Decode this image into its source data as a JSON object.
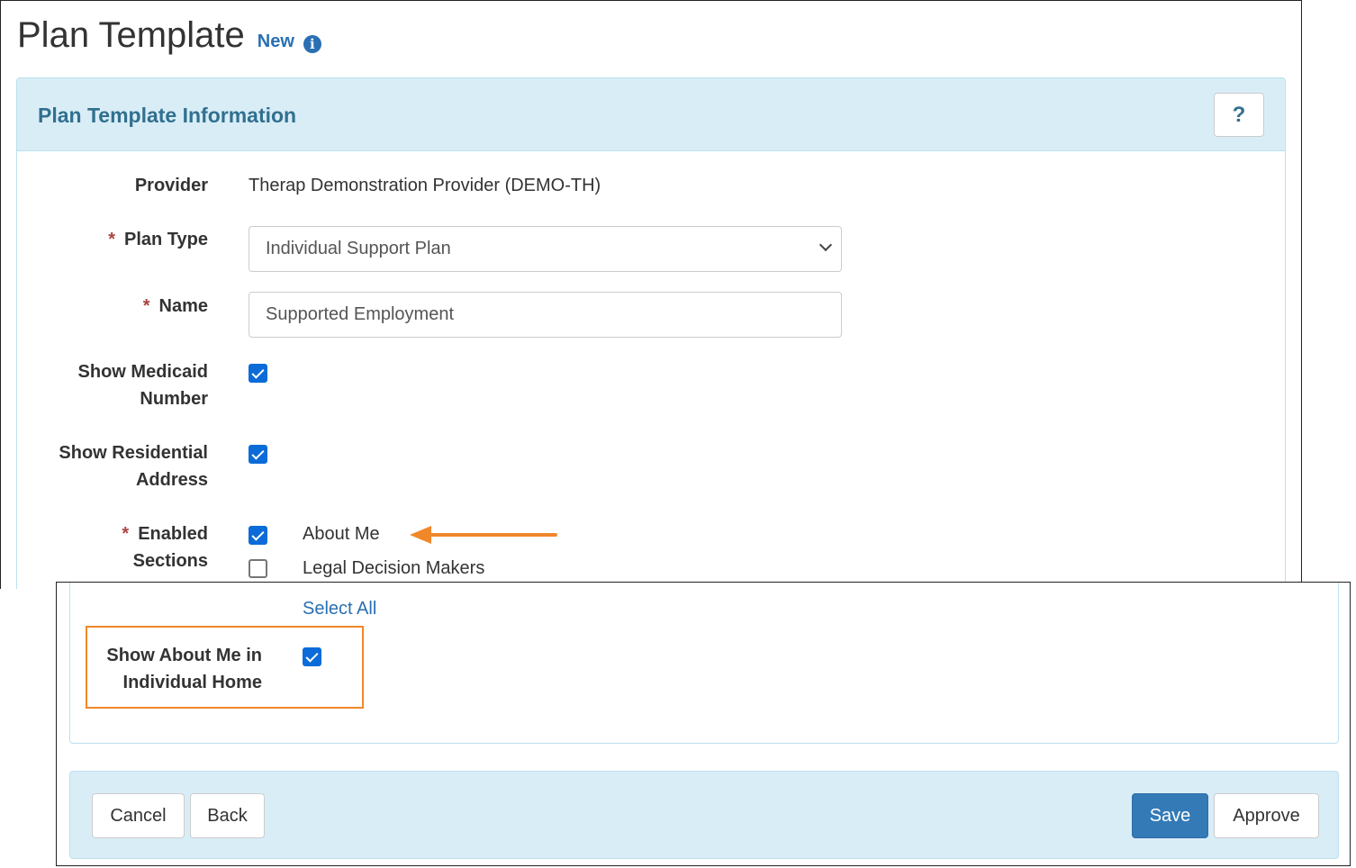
{
  "page": {
    "title": "Plan Template",
    "status": "New",
    "info_icon": "info-circle-icon"
  },
  "panel": {
    "title": "Plan Template Information",
    "help_label": "?"
  },
  "form": {
    "provider": {
      "label": "Provider",
      "value": "Therap Demonstration Provider (DEMO-TH)"
    },
    "plan_type": {
      "required_mark": "*",
      "label": "Plan Type",
      "value": "Individual Support Plan"
    },
    "name": {
      "required_mark": "*",
      "label": "Name",
      "value": "Supported Employment"
    },
    "show_medicaid": {
      "label_line1": "Show Medicaid",
      "label_line2": "Number",
      "checked": true
    },
    "show_residential": {
      "label_line1": "Show Residential",
      "label_line2": "Address",
      "checked": true
    },
    "enabled_sections": {
      "required_mark": "*",
      "label_line1": "Enabled",
      "label_line2": "Sections",
      "options": [
        {
          "label": "About Me",
          "checked": true
        },
        {
          "label": "Legal Decision Makers",
          "checked": false
        }
      ],
      "select_all": "Select All"
    },
    "show_about_me": {
      "label_line1": "Show About Me in",
      "label_line2": "Individual Home",
      "checked": true
    }
  },
  "footer": {
    "cancel": "Cancel",
    "back": "Back",
    "save": "Save",
    "approve": "Approve"
  },
  "colors": {
    "accent": "#2a6fb3",
    "panel_bg": "#d9edf7",
    "panel_title": "#31708f",
    "required": "#a94442",
    "checkbox": "#0b6bd8",
    "annotation": "#f0882a",
    "primary_button": "#337ab7"
  }
}
